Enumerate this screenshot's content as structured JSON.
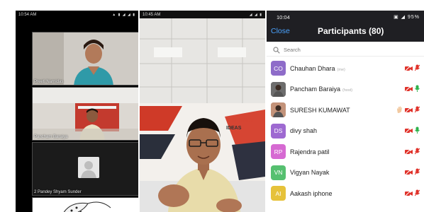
{
  "panel1": {
    "status_time": "10:54 AM",
    "tiles": [
      {
        "name": "Preeti Narnidas"
      },
      {
        "name": "Pancham Baraiya"
      },
      {
        "name": "2 Pandey Shyam Sunder"
      }
    ]
  },
  "panel2": {
    "status_time": "10:45 AM",
    "banner_line1": "GTU INNOV",
    "banner_line2": "IDEAS"
  },
  "panel3": {
    "status_time": "10:04",
    "battery": "95%",
    "close_label": "Close",
    "title": "Participants (80)",
    "search_placeholder": "Search",
    "participants": [
      {
        "initials": "CO",
        "name": "Chauhan Dhara",
        "tag": "(me)",
        "color": "#8e6cc9",
        "raised_hand": false,
        "mic": "muted"
      },
      {
        "initials": "",
        "name": "Pancham Baraiya",
        "tag": "(host)",
        "color": "#6d6d6d",
        "raised_hand": false,
        "mic": "active"
      },
      {
        "initials": "",
        "name": "SURESH KUMAWAT",
        "tag": "",
        "color": "#c3937a",
        "raised_hand": true,
        "mic": "muted"
      },
      {
        "initials": "DS",
        "name": "divy shah",
        "tag": "",
        "color": "#9e6ad1",
        "raised_hand": false,
        "mic": "active"
      },
      {
        "initials": "RP",
        "name": "Rajendra patil",
        "tag": "",
        "color": "#d66ad2",
        "raised_hand": false,
        "mic": "muted"
      },
      {
        "initials": "VN",
        "name": "Vigyan Nayak",
        "tag": "",
        "color": "#56c070",
        "raised_hand": false,
        "mic": "muted"
      },
      {
        "initials": "AI",
        "name": "Aakash iphone",
        "tag": "",
        "color": "#e6c23a",
        "raised_hand": false,
        "mic": "muted"
      }
    ]
  }
}
